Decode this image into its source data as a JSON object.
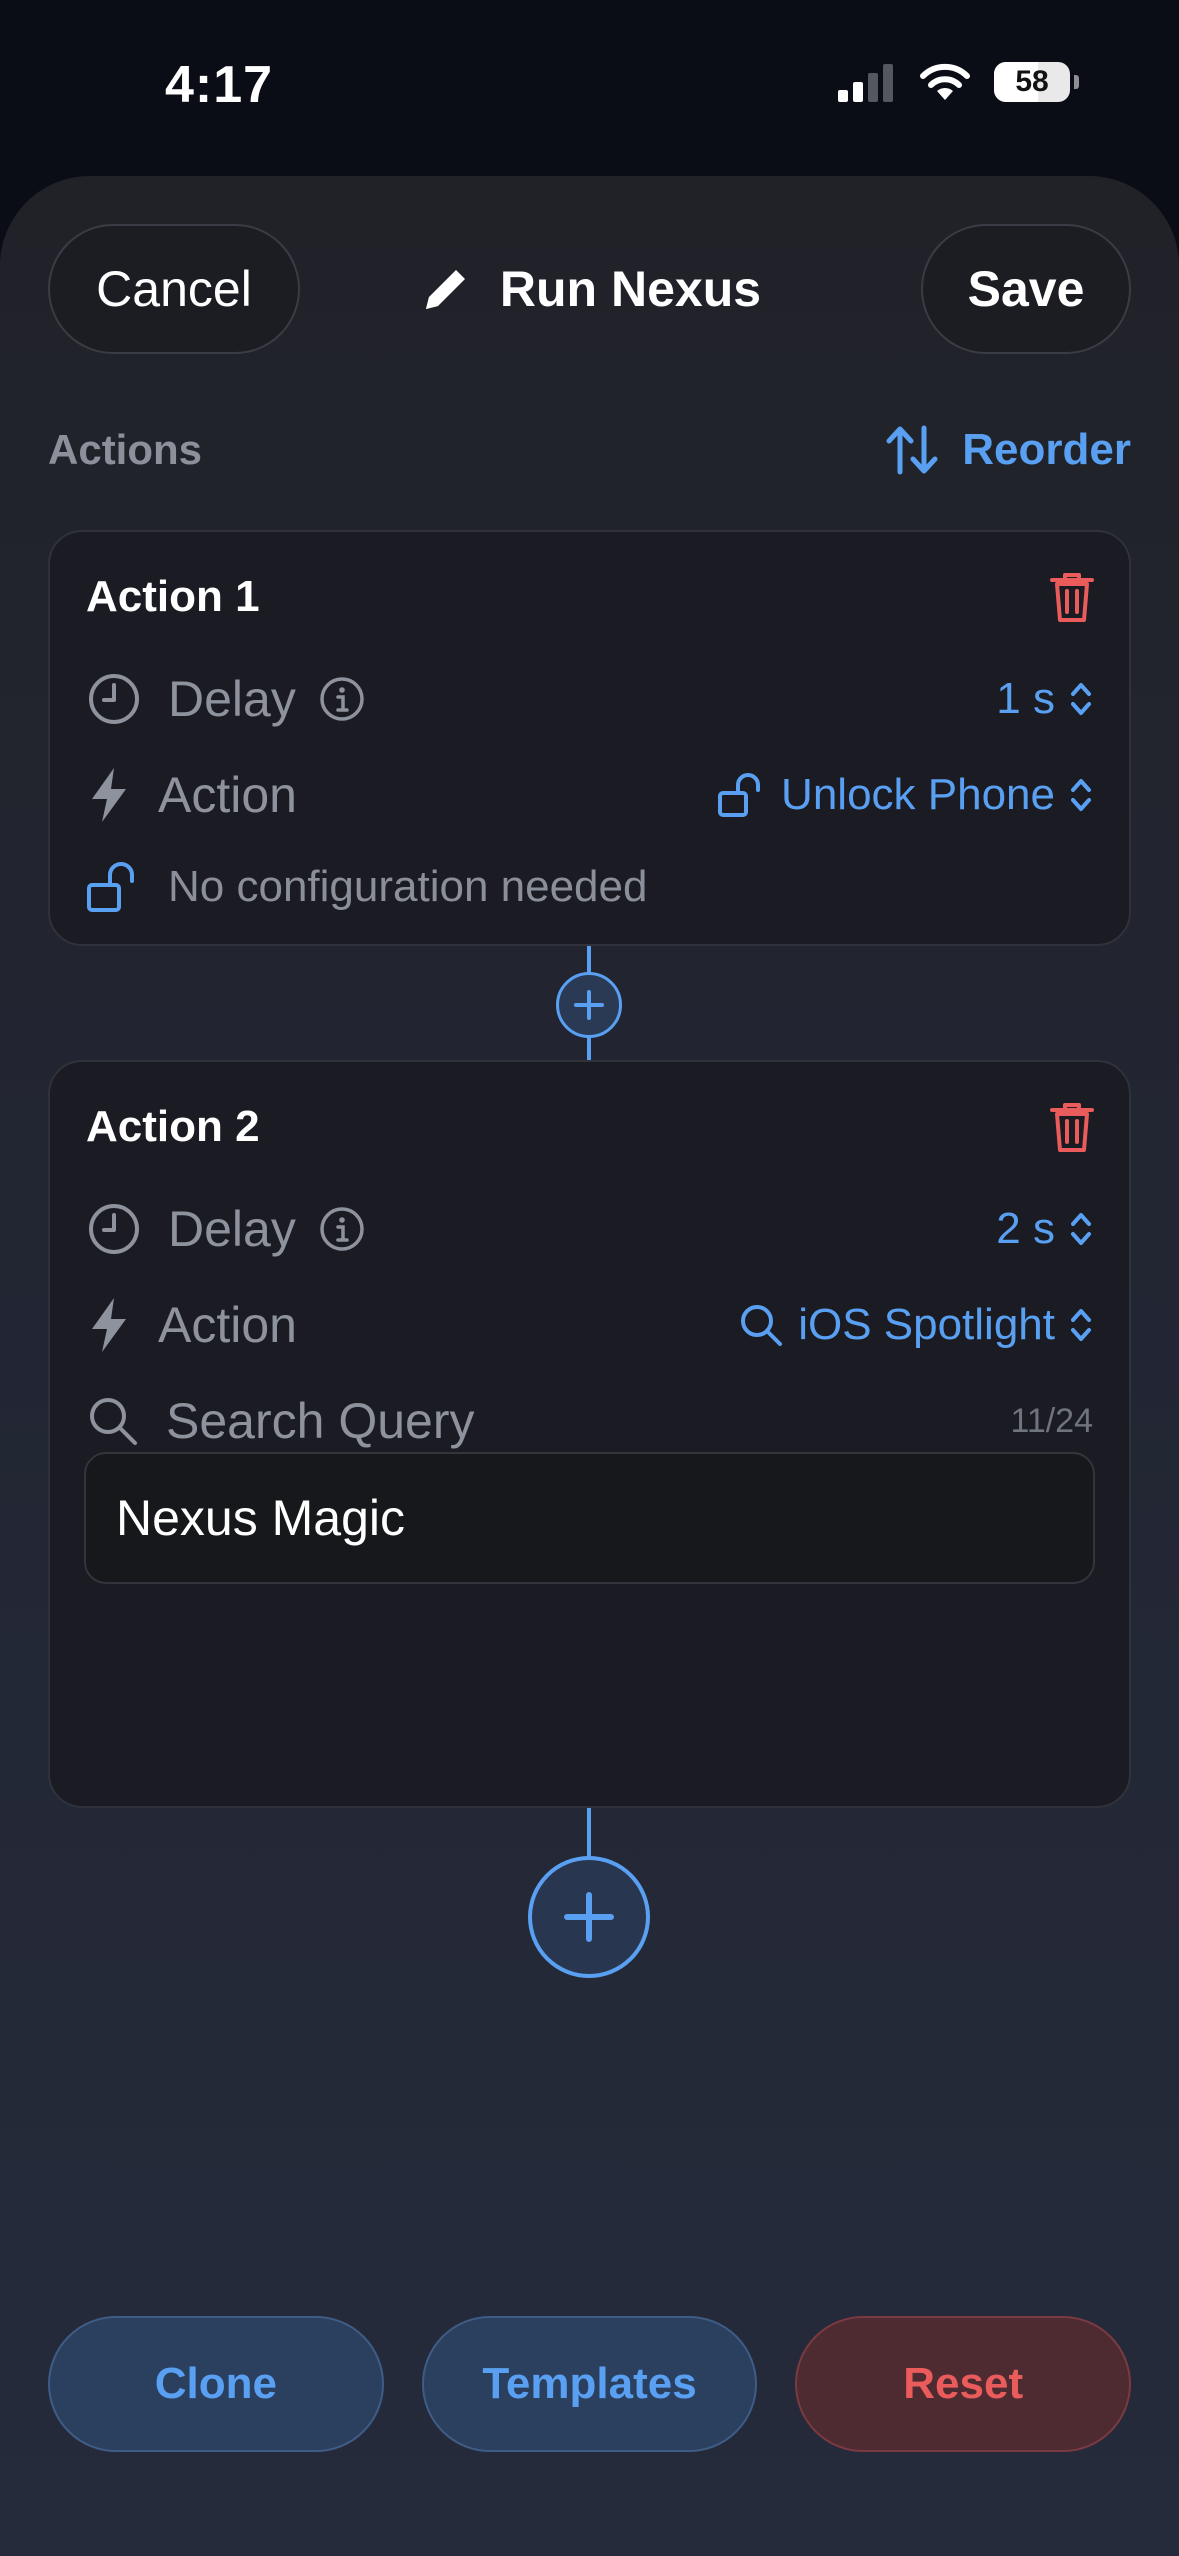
{
  "status_bar": {
    "time": "4:17",
    "battery_level": "58",
    "battery_fraction": 0.58
  },
  "nav": {
    "cancel_label": "Cancel",
    "title": "Run Nexus",
    "save_label": "Save"
  },
  "section": {
    "title": "Actions",
    "reorder_label": "Reorder"
  },
  "actions": [
    {
      "title": "Action 1",
      "delay_label": "Delay",
      "delay_value": "1 s",
      "action_label": "Action",
      "action_value": "Unlock Phone",
      "action_icon": "unlock-icon",
      "config_note": "No configuration needed"
    },
    {
      "title": "Action 2",
      "delay_label": "Delay",
      "delay_value": "2 s",
      "action_label": "Action",
      "action_value": "iOS Spotlight",
      "action_icon": "search-icon",
      "query_label": "Search Query",
      "query_counter": "11/24",
      "query_value": "Nexus Magic"
    }
  ],
  "bottom": {
    "clone_label": "Clone",
    "templates_label": "Templates",
    "reset_label": "Reset"
  },
  "colors": {
    "accent": "#5aa0f2",
    "danger": "#ea5c5c",
    "background": "#0b0d16",
    "card": "#1b1c23"
  }
}
